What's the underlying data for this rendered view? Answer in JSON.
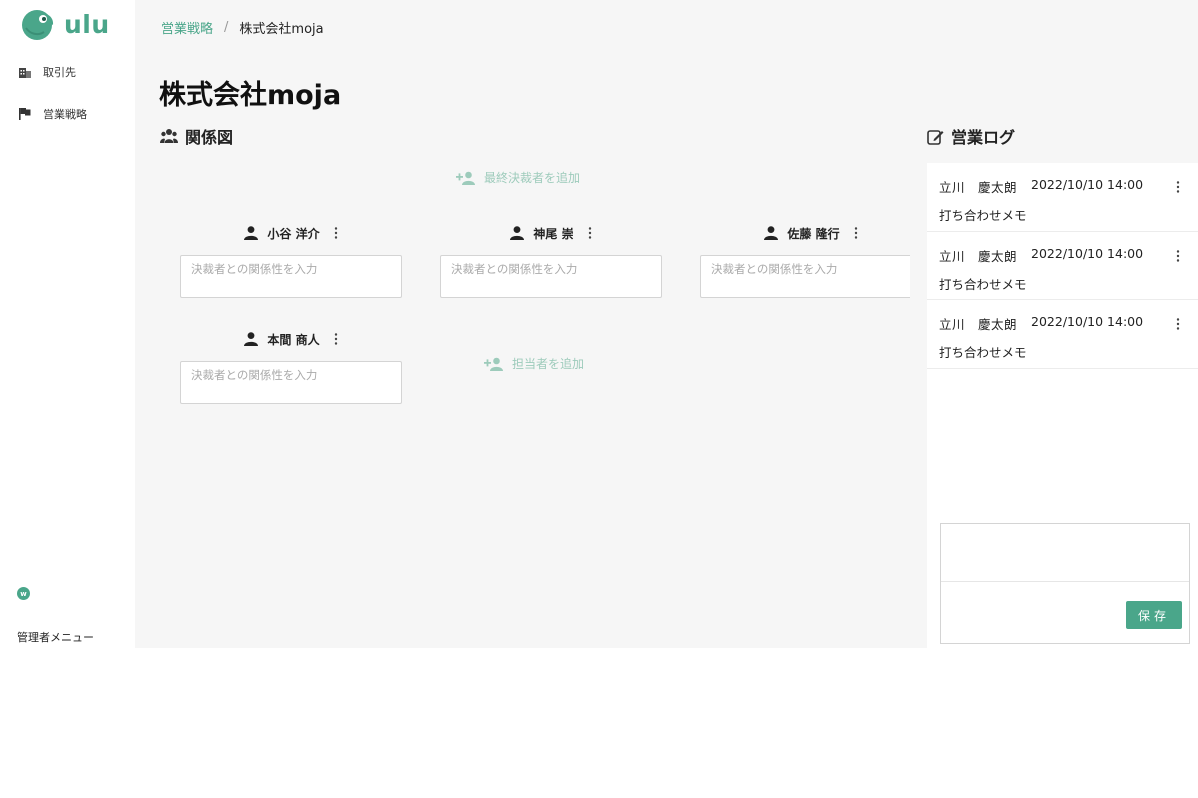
{
  "brand": {
    "name": "ulu",
    "color": "#4aa68a"
  },
  "sidebar": {
    "items": [
      {
        "label": "取引先",
        "icon": "building-icon"
      },
      {
        "label": "営業戦略",
        "icon": "flag-icon"
      }
    ],
    "user_initial": "w",
    "admin_menu_label": "管理者メニュー"
  },
  "breadcrumb": {
    "parent": "営業戦略",
    "separator": "/",
    "current": "株式会社moja"
  },
  "page_title": "株式会社moja",
  "relationship": {
    "title": "関係図",
    "add_final_decision_maker": "最終決裁者を追加",
    "add_representative": "担当者を追加",
    "input_placeholder": "決裁者との関係性を入力",
    "people": [
      {
        "name": "小谷 洋介"
      },
      {
        "name": "神尾 崇"
      },
      {
        "name": "佐藤 隆行"
      },
      {
        "name": "本間 商人"
      }
    ]
  },
  "sales_log": {
    "title": "営業ログ",
    "entries": [
      {
        "author": "立川　慶太朗",
        "datetime": "2022/10/10 14:00",
        "text": "打ち合わせメモ"
      },
      {
        "author": "立川　慶太朗",
        "datetime": "2022/10/10 14:00",
        "text": "打ち合わせメモ"
      },
      {
        "author": "立川　慶太朗",
        "datetime": "2022/10/10 14:00",
        "text": "打ち合わせメモ"
      }
    ],
    "save_label": "保存"
  },
  "colors": {
    "accent": "#4aa68a",
    "accent_light": "#9dcbbb",
    "background": "#f6f6f6"
  }
}
